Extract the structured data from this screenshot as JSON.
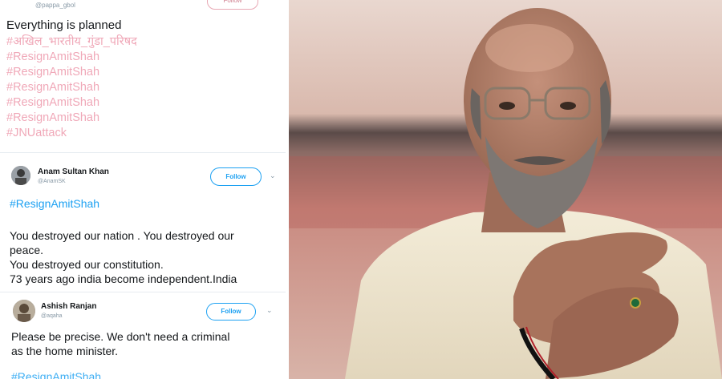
{
  "tweet_top": {
    "handle": "@pappa_gbol",
    "follow_label": "Follow",
    "text": "Everything is planned",
    "hashtags": [
      "#अखिल_भारतीय_गुंडा_परिषद",
      "#ResignAmitShah",
      "#ResignAmitShah",
      "#ResignAmitShah",
      "#ResignAmitShah",
      "#ResignAmitShah",
      "#JNUattack"
    ],
    "hashtag_color": "#f0a8b8"
  },
  "tweet_middle": {
    "name": "Anam Sultan Khan",
    "handle": "@AnamSK",
    "follow_label": "Follow",
    "hashtag": "#ResignAmitShah",
    "lines": [
      "You destroyed our nation . You destroyed our",
      "peace.",
      "You destroyed our constitution.",
      "73 years ago india become independent.India"
    ]
  },
  "tweet_bottom": {
    "name": "Ashish Ranjan",
    "handle": "@aqaha",
    "follow_label": "Follow",
    "lines": [
      "Please be precise. We don't need a criminal",
      "as the home minister."
    ],
    "hashtag": "#ResignAmitShah"
  },
  "colors": {
    "link_blue": "#1da1f2",
    "text": "#14171a",
    "muted": "#8899a6"
  },
  "icons": {
    "chevron": "chevron-down-icon"
  }
}
